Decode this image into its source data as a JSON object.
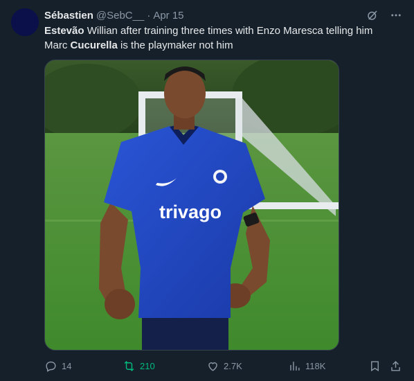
{
  "tweet": {
    "author_name": "Sébastien",
    "handle": "@SebC__",
    "separator": "·",
    "date": "Apr 15",
    "text": {
      "t1_bold": "Estevão",
      "t2": " Willian after training three times with Enzo Maresca telling him Marc ",
      "t3_bold": "Cucurella",
      "t4": " is the playmaker not him"
    },
    "image": {
      "shirt_sponsor": "trivago"
    },
    "stats": {
      "replies": "14",
      "retweets": "210",
      "likes": "2.7K",
      "views": "118K"
    }
  },
  "colors": {
    "background": "#15202b",
    "retweet_active": "#00ba7c",
    "secondary_text": "#8b98a5",
    "avatar": "#0b0f4a",
    "shirt": "#1f43b8"
  },
  "icons": [
    "grok-icon",
    "more-icon",
    "reply-icon",
    "retweet-icon",
    "like-icon",
    "views-icon",
    "bookmark-icon",
    "share-icon"
  ]
}
